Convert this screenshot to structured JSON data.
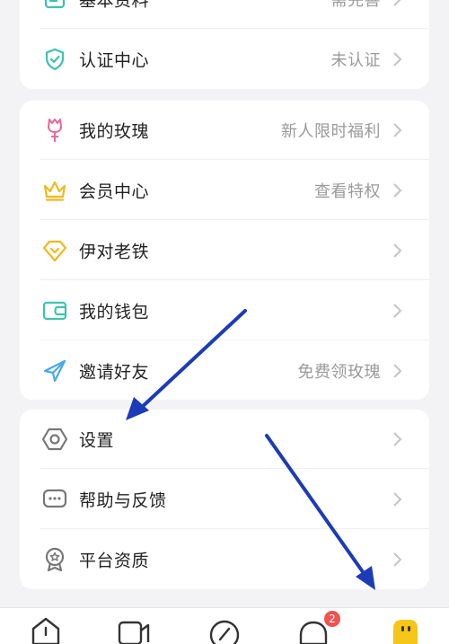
{
  "card1": {
    "rows": [
      {
        "label": "基本资料",
        "value": "需完善",
        "icon": "profile-card-icon"
      },
      {
        "label": "认证中心",
        "value": "未认证",
        "icon": "shield-check-icon"
      }
    ]
  },
  "card2": {
    "rows": [
      {
        "label": "我的玫瑰",
        "value": "新人限时福利",
        "icon": "rose-icon"
      },
      {
        "label": "会员中心",
        "value": "查看特权",
        "icon": "crown-icon"
      },
      {
        "label": "伊对老铁",
        "value": "",
        "icon": "diamond-heart-icon"
      },
      {
        "label": "我的钱包",
        "value": "",
        "icon": "wallet-icon"
      },
      {
        "label": "邀请好友",
        "value": "免费领玫瑰",
        "icon": "paper-plane-icon"
      }
    ]
  },
  "card3": {
    "rows": [
      {
        "label": "设置",
        "value": "",
        "icon": "settings-hexagon-icon"
      },
      {
        "label": "帮助与反馈",
        "value": "",
        "icon": "chat-bubble-dots-icon"
      },
      {
        "label": "平台资质",
        "value": "",
        "icon": "award-badge-icon"
      }
    ]
  },
  "tabbar": {
    "items": [
      {
        "icon": "home-icon"
      },
      {
        "icon": "video-camera-icon"
      },
      {
        "icon": "compass-icon"
      },
      {
        "icon": "message-bubble-icon",
        "badge": "2"
      },
      {
        "icon": "me-avatar-icon"
      }
    ]
  },
  "colors": {
    "background": "#f3f3f5",
    "card": "#ffffff",
    "teal": "#3cc3b0",
    "rose": "#e8679a",
    "gold": "#f2b81f",
    "gray_icon": "#777777",
    "chevron": "#c4c4c4",
    "badge": "#f2514f",
    "arrow": "#1b3bb8"
  }
}
